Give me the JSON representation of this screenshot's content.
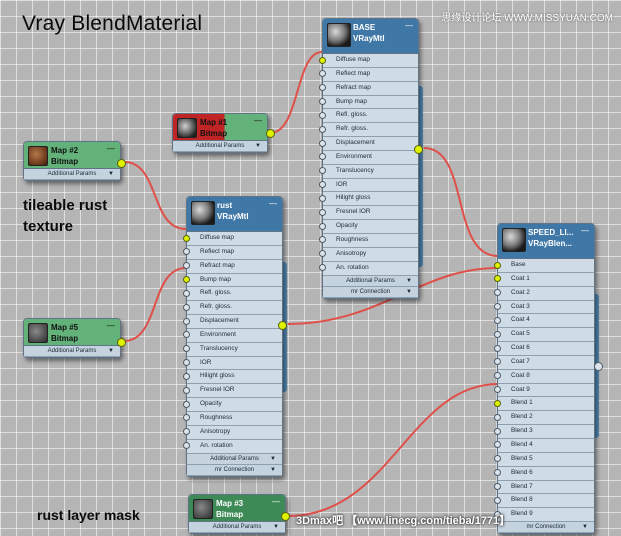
{
  "title": "Vray BlendMaterial",
  "labels": {
    "rust_texture_line1": "tileable rust",
    "rust_texture_line2": "texture",
    "rust_mask": "rust layer mask"
  },
  "watermark": {
    "top_right": "思缘设计论坛  WWW.MISSYUAN.COM",
    "bottom": "3Dmax吧  【www.linecg.com/tieba/1771】"
  },
  "nodes": {
    "base": {
      "name": "BASE",
      "type": "VRayMtl",
      "slots": [
        "Diffuse map",
        "Reflect map",
        "Refract map",
        "Bump map",
        "Refl. gloss.",
        "Refr. gloss.",
        "Displacement",
        "Environment",
        "Translucency",
        "IOR",
        "Hilight gloss",
        "Fresnel IOR",
        "Opacity",
        "Roughness",
        "Anisotropy",
        "An. rotation"
      ],
      "footer1": "Additional Params",
      "footer2": "mr Connection"
    },
    "rust": {
      "name": "rust",
      "type": "VRayMtl",
      "slots": [
        "Diffuse map",
        "Reflect map",
        "Refract map",
        "Bump map",
        "Refl. gloss.",
        "Refr. gloss.",
        "Displacement",
        "Environment",
        "Translucency",
        "IOR",
        "Hilight gloss",
        "Fresnel IOR",
        "Opacity",
        "Roughness",
        "Anisotropy",
        "An. rotation"
      ],
      "footer1": "Additional Params",
      "footer2": "mr Connection"
    },
    "blend": {
      "name": "SPEED_LI...",
      "type": "VRayBlen...",
      "slots": [
        "Base",
        "Coat 1",
        "Coat 2",
        "Coat 3",
        "Coat 4",
        "Coat 5",
        "Coat 6",
        "Coat 7",
        "Coat 8",
        "Coat 9",
        "Blend 1",
        "Blend 2",
        "Blend 3",
        "Blend 4",
        "Blend 5",
        "Blend 6",
        "Blend 7",
        "Blend 8",
        "Blend 9"
      ],
      "footer": "mr Connection"
    },
    "map1": {
      "name": "Map #1",
      "type": "Bitmap",
      "footer": "Additional Params"
    },
    "map2": {
      "name": "Map #2",
      "type": "Bitmap",
      "footer": "Additional Params"
    },
    "map3": {
      "name": "Map #3",
      "type": "Bitmap",
      "footer": "Additional Params"
    },
    "map5": {
      "name": "Map #5",
      "type": "Bitmap",
      "footer": "Additional Params"
    }
  },
  "colors": {
    "wire": "#e0504a",
    "socket_active": "#dff200",
    "node_body": "#c5d3df",
    "map_header": "#63b27a",
    "mtl_header": "#3f77a6"
  }
}
